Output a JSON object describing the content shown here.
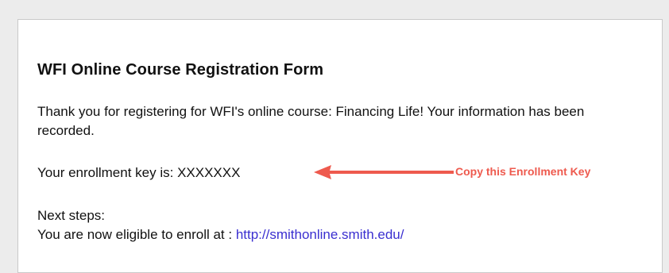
{
  "form": {
    "title": "WFI Online Course Registration Form",
    "thank_you_text": "Thank you for registering for WFI's online course: Financing Life!  Your information has been recorded.",
    "enrollment_key_label": "Your enrollment key is: ",
    "enrollment_key_value": "XXXXXXX",
    "next_steps_label": "Next steps:",
    "enroll_text": "You are now eligible to enroll at : ",
    "enroll_link": "http://smithonline.smith.edu/"
  },
  "annotation": {
    "callout_text": "Copy this Enrollment Key",
    "arrow_icon": "left-arrow-icon",
    "color": "#ee5a4e"
  },
  "colors": {
    "background": "#ececec",
    "panel": "#ffffff",
    "text": "#111111",
    "link": "#3a2fd0"
  }
}
